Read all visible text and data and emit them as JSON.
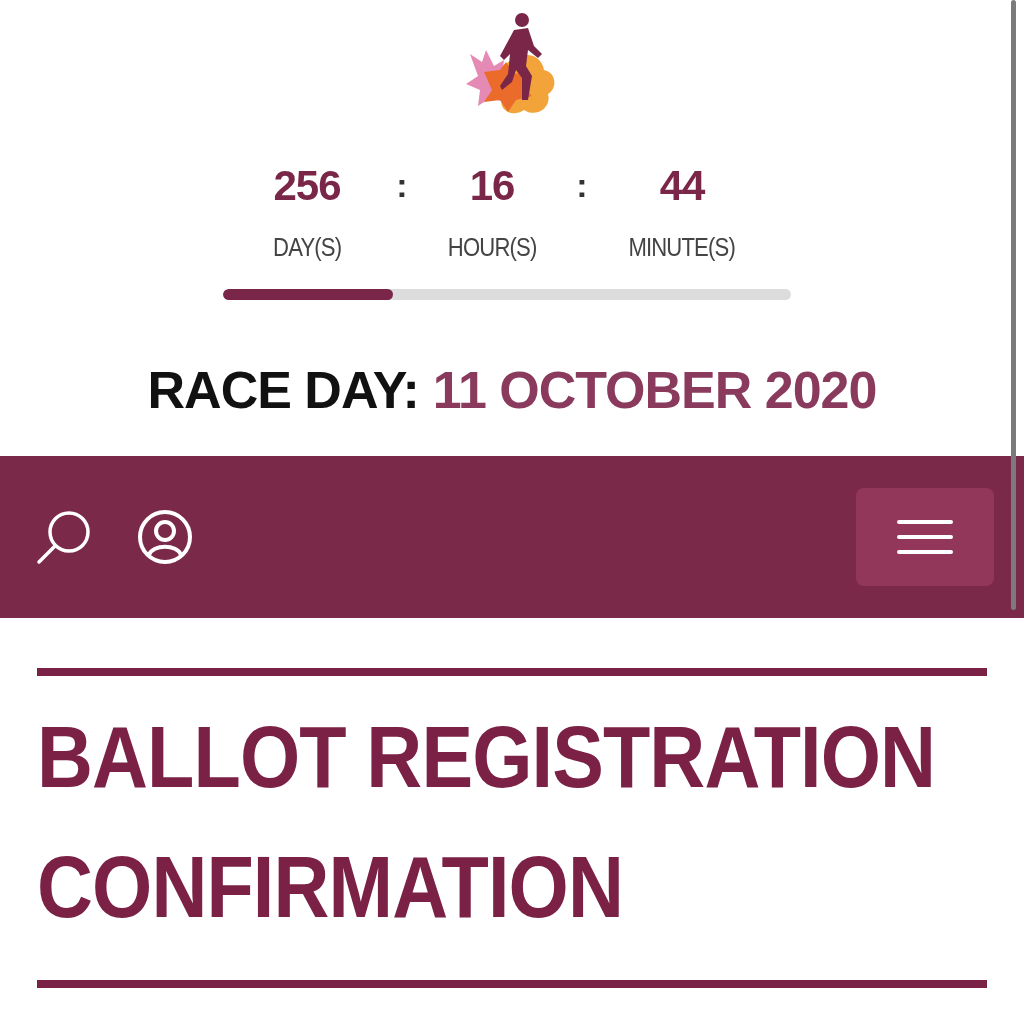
{
  "countdown": {
    "units": [
      {
        "value": "256",
        "label": "DAY(S)"
      },
      {
        "value": "16",
        "label": "HOUR(S)"
      },
      {
        "value": "44",
        "label": "MINUTE(S)"
      }
    ],
    "separators": [
      ":",
      ":"
    ],
    "progress": {
      "level": 0.3
    }
  },
  "race_day": {
    "label": "RACE DAY:",
    "date": "11 OCTOBER 2020"
  },
  "page": {
    "title": "BALLOT REGISTRATION CONFIRMATION"
  }
}
